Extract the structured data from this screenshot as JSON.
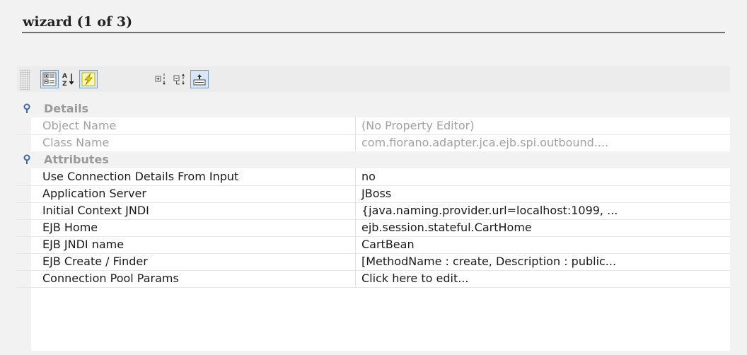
{
  "window": {
    "title": "wizard (1 of 3)"
  },
  "toolbar": {
    "buttons": [
      {
        "name": "categorized-view-icon",
        "pressed": true
      },
      {
        "name": "sort-alphabetical-icon",
        "pressed": false
      },
      {
        "name": "show-expert-properties-icon",
        "pressed": true
      },
      {
        "name": "expand-all-icon",
        "pressed": false
      },
      {
        "name": "collapse-all-icon",
        "pressed": false
      },
      {
        "name": "show-description-icon",
        "pressed": true
      }
    ]
  },
  "sheet": {
    "details": {
      "label": "Details",
      "rows": [
        {
          "name": "Object Name",
          "value": "(No Property Editor)"
        },
        {
          "name": "Class Name",
          "value": "com.fiorano.adapter.jca.ejb.spi.outbound...."
        }
      ]
    },
    "attributes": {
      "label": "Attributes",
      "rows": [
        {
          "name": "Use Connection Details From Input",
          "value": "no"
        },
        {
          "name": "Application Server",
          "value": "JBoss"
        },
        {
          "name": "Initial Context JNDI",
          "value": "{java.naming.provider.url=localhost:1099, ..."
        },
        {
          "name": "EJB Home",
          "value": "ejb.session.stateful.CartHome"
        },
        {
          "name": "EJB JNDI name",
          "value": "CartBean"
        },
        {
          "name": "EJB Create / Finder",
          "value": "[MethodName : create, Description : public..."
        },
        {
          "name": "Connection Pool Params",
          "value": "Click here to edit..."
        }
      ]
    }
  },
  "colors": {
    "accent": "#7b9ec9",
    "pressed_bg": "#d9e6f5",
    "category_bg": "#f2f2f2"
  }
}
